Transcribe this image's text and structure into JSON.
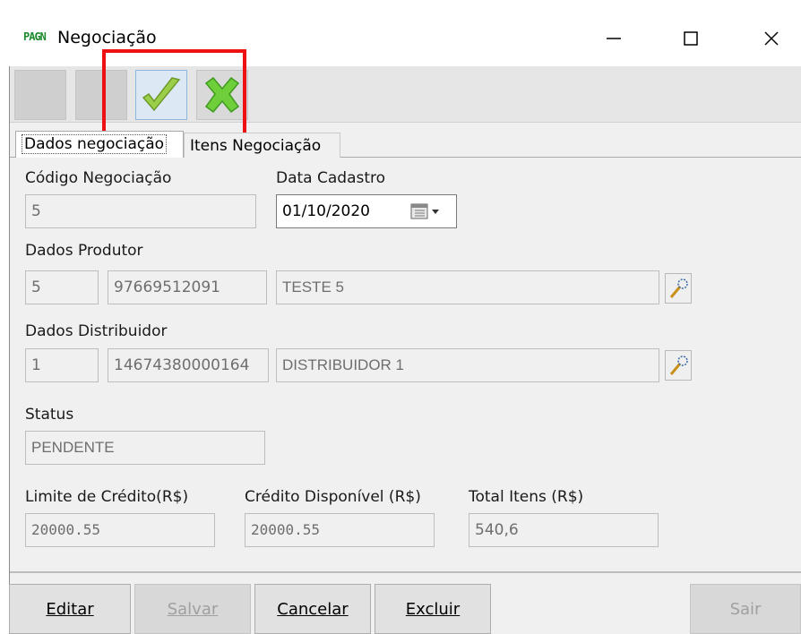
{
  "window": {
    "logo_text": "PAGN",
    "title": "Negociação",
    "controls": {
      "minimize": "—",
      "maximize": "☐",
      "close": "✕"
    }
  },
  "toolbar": {
    "buttons": [
      {
        "name": "blank-1"
      },
      {
        "name": "blank-2"
      },
      {
        "name": "confirm",
        "icon": "checkmark-icon",
        "color": "#8cc63f"
      },
      {
        "name": "cancel",
        "icon": "x-icon",
        "color": "#6abf2e"
      }
    ]
  },
  "tabs": [
    {
      "label": "Dados negociação",
      "selected": true
    },
    {
      "label": "Itens Negociação",
      "selected": false
    }
  ],
  "form": {
    "codigo": {
      "label": "Código Negociação",
      "value": "5"
    },
    "data_cadastro": {
      "label": "Data Cadastro",
      "value": "01/10/2020"
    },
    "produtor": {
      "label": "Dados Produtor",
      "code": "5",
      "doc": "97669512091",
      "name": "TESTE 5"
    },
    "distribuidor": {
      "label": "Dados Distribuidor",
      "code": "1",
      "doc": "14674380000164",
      "name": "DISTRIBUIDOR 1"
    },
    "status": {
      "label": "Status",
      "value": "PENDENTE"
    },
    "limite": {
      "label": "Limite de Crédito(R$)",
      "value": "20000.55"
    },
    "credito": {
      "label": "Crédito Disponível (R$)",
      "value": "20000.55"
    },
    "total": {
      "label": "Total Itens (R$)",
      "value": "540,6"
    }
  },
  "buttons": {
    "editar": "Editar",
    "salvar": "Salvar",
    "cancelar": "Cancelar",
    "excluir": "Excluir",
    "sair": "Sair"
  }
}
